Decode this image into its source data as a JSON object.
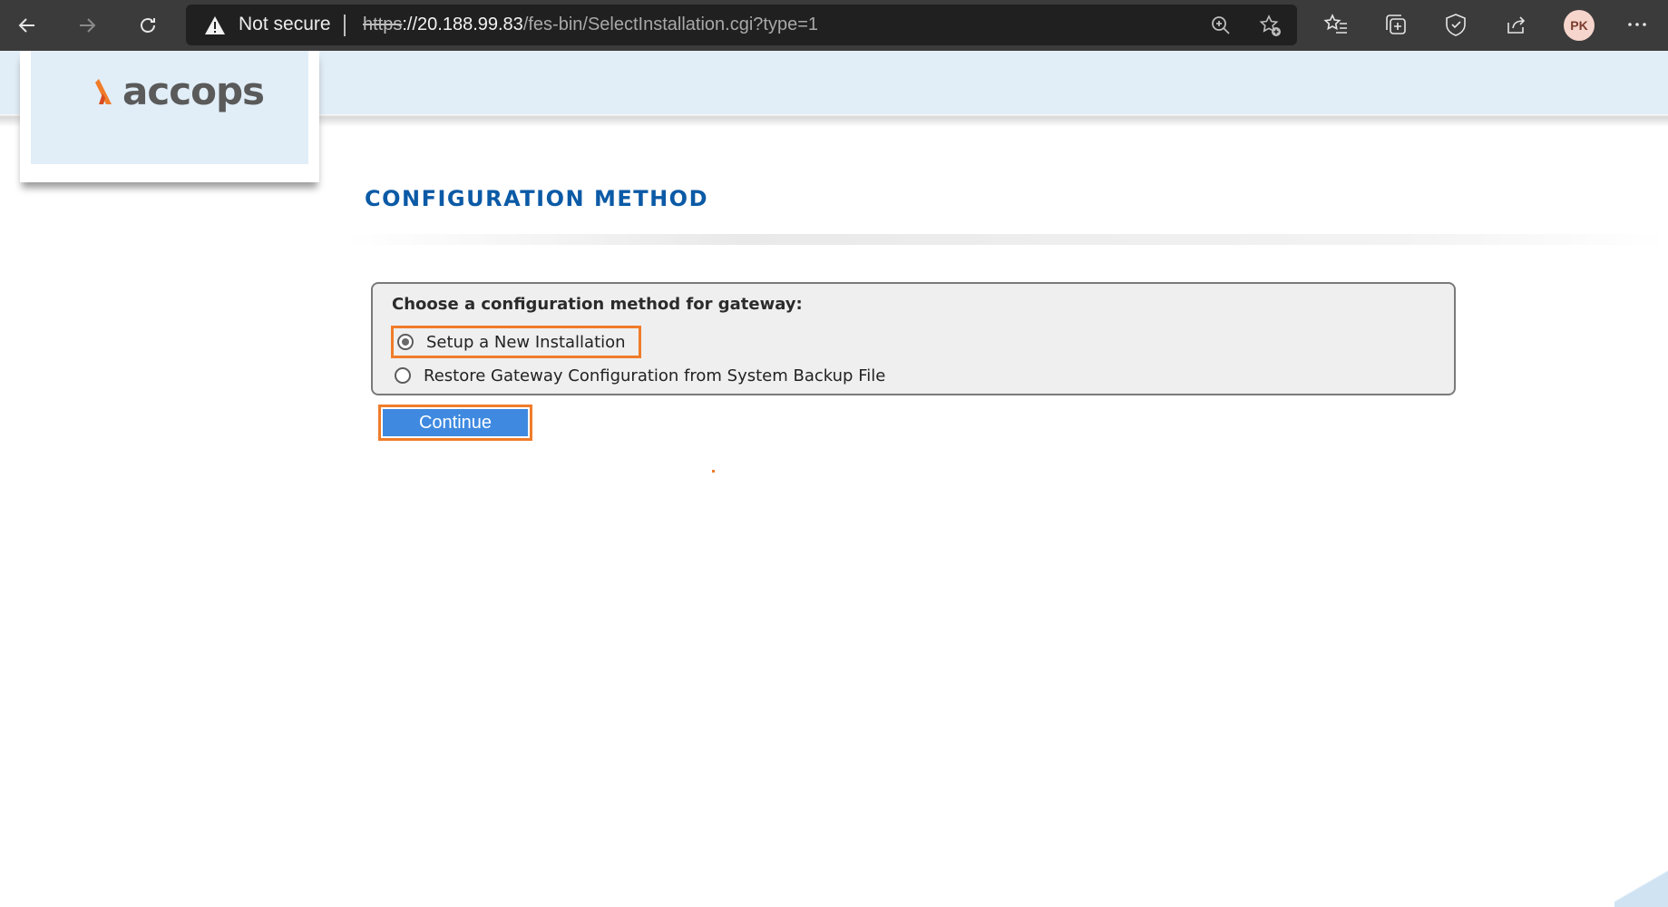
{
  "browser": {
    "security_label": "Not secure",
    "url_scheme": "https",
    "url_host": "://20.188.99.83",
    "url_path": "/fes-bin/SelectInstallation.cgi?type=1",
    "profile_initials": "PK",
    "icons": [
      "back-icon",
      "forward-icon",
      "refresh-icon",
      "warning-icon",
      "zoom-icon",
      "add-favorite-icon",
      "favorites-icon",
      "collections-icon",
      "browser-essentials-icon",
      "share-icon",
      "more-icon"
    ]
  },
  "header": {
    "logo_text": "accops"
  },
  "main": {
    "title": "CONFIGURATION METHOD",
    "prompt": "Choose a configuration method for gateway:",
    "options": [
      {
        "label": "Setup a New Installation",
        "selected": true
      },
      {
        "label": "Restore Gateway Configuration from System Backup File",
        "selected": false
      }
    ],
    "continue_label": "Continue"
  },
  "colors": {
    "header_band": "#e1eef8",
    "title": "#0b5aa6",
    "button": "#3f8ae0",
    "highlight": "#f07c2a"
  }
}
